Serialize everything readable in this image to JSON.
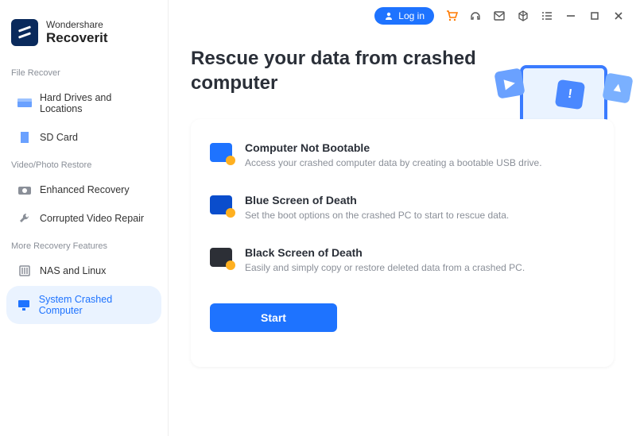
{
  "brand": {
    "top": "Wondershare",
    "bottom": "Recoverit"
  },
  "topbar": {
    "login_label": "Log in"
  },
  "sidebar": {
    "sections": [
      {
        "label": "File Recover",
        "items": [
          {
            "label": "Hard Drives and Locations",
            "icon": "drive-icon"
          },
          {
            "label": "SD Card",
            "icon": "sdcard-icon"
          }
        ]
      },
      {
        "label": "Video/Photo Restore",
        "items": [
          {
            "label": "Enhanced Recovery",
            "icon": "camera-icon"
          },
          {
            "label": "Corrupted Video Repair",
            "icon": "wrench-icon"
          }
        ]
      },
      {
        "label": "More Recovery Features",
        "items": [
          {
            "label": "NAS and Linux",
            "icon": "server-icon"
          },
          {
            "label": "System Crashed Computer",
            "icon": "monitor-icon",
            "active": true
          }
        ]
      }
    ]
  },
  "main": {
    "title": "Rescue your data from crashed computer",
    "features": [
      {
        "title": "Computer Not Bootable",
        "desc": "Access your crashed computer data by creating a bootable USB drive."
      },
      {
        "title": "Blue Screen of Death",
        "desc": "Set the boot options on the crashed PC to start to rescue data."
      },
      {
        "title": "Black Screen of Death",
        "desc": "Easily and simply copy or restore deleted data from a crashed PC."
      }
    ],
    "start_label": "Start"
  }
}
